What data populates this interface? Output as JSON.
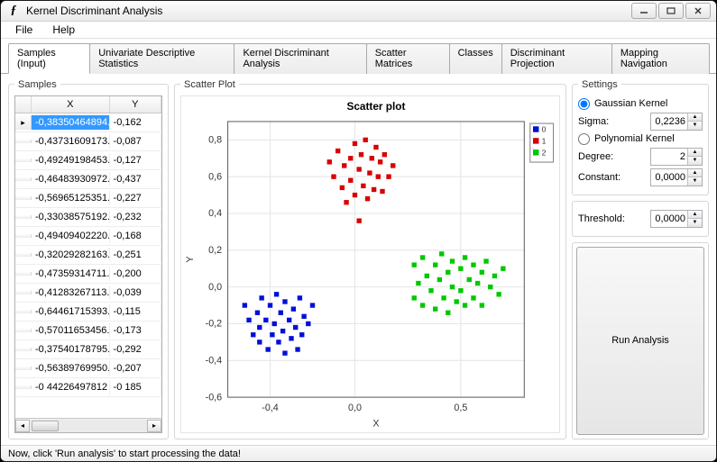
{
  "window": {
    "title": "Kernel Discriminant Analysis"
  },
  "menu": {
    "file": "File",
    "help": "Help"
  },
  "tabs": [
    "Samples (Input)",
    "Univariate Descriptive Statistics",
    "Kernel Discriminant Analysis",
    "Scatter Matrices",
    "Classes",
    "Discriminant Projection",
    "Mapping Navigation"
  ],
  "samples": {
    "legend": "Samples",
    "headers": {
      "x": "X",
      "y": "Y"
    },
    "rows": [
      {
        "x": "-0,38350464894...",
        "y": "-0,162"
      },
      {
        "x": "-0,43731609173...",
        "y": "-0,087"
      },
      {
        "x": "-0,49249198453...",
        "y": "-0,127"
      },
      {
        "x": "-0,46483930972...",
        "y": "-0,437"
      },
      {
        "x": "-0,56965125351...",
        "y": "-0,227"
      },
      {
        "x": "-0,33038575192...",
        "y": "-0,232"
      },
      {
        "x": "-0,49409402220...",
        "y": "-0,168"
      },
      {
        "x": "-0,32029282163...",
        "y": "-0,251"
      },
      {
        "x": "-0,47359314711...",
        "y": "-0,200"
      },
      {
        "x": "-0,41283267113...",
        "y": "-0,039"
      },
      {
        "x": "-0,64461715393...",
        "y": "-0,115"
      },
      {
        "x": "-0,57011653456...",
        "y": "-0,173"
      },
      {
        "x": "-0,37540178795...",
        "y": "-0,292"
      },
      {
        "x": "-0,56389769950...",
        "y": "-0,207"
      },
      {
        "x": "-0 44226497812",
        "y": "-0 185"
      }
    ]
  },
  "scatter": {
    "legend": "Scatter Plot",
    "legend_items": [
      "0",
      "1",
      "2"
    ]
  },
  "chart_data": {
    "type": "scatter",
    "title": "Scatter plot",
    "xlabel": "X",
    "ylabel": "Y",
    "xlim": [
      -0.6,
      0.8
    ],
    "ylim": [
      -0.6,
      0.9
    ],
    "xticks": [
      -0.4,
      0.0,
      0.5
    ],
    "yticks": [
      -0.6,
      -0.4,
      -0.2,
      0.0,
      0.2,
      0.4,
      0.6,
      0.8
    ],
    "series": [
      {
        "name": "0",
        "color": "#0010d8",
        "points": [
          [
            -0.52,
            -0.1
          ],
          [
            -0.5,
            -0.18
          ],
          [
            -0.48,
            -0.26
          ],
          [
            -0.46,
            -0.14
          ],
          [
            -0.45,
            -0.22
          ],
          [
            -0.45,
            -0.3
          ],
          [
            -0.44,
            -0.06
          ],
          [
            -0.42,
            -0.18
          ],
          [
            -0.41,
            -0.34
          ],
          [
            -0.4,
            -0.1
          ],
          [
            -0.39,
            -0.26
          ],
          [
            -0.38,
            -0.2
          ],
          [
            -0.37,
            -0.04
          ],
          [
            -0.36,
            -0.3
          ],
          [
            -0.35,
            -0.14
          ],
          [
            -0.34,
            -0.24
          ],
          [
            -0.33,
            -0.08
          ],
          [
            -0.33,
            -0.36
          ],
          [
            -0.31,
            -0.18
          ],
          [
            -0.3,
            -0.28
          ],
          [
            -0.29,
            -0.12
          ],
          [
            -0.28,
            -0.22
          ],
          [
            -0.27,
            -0.34
          ],
          [
            -0.26,
            -0.06
          ],
          [
            -0.25,
            -0.26
          ],
          [
            -0.24,
            -0.16
          ],
          [
            -0.22,
            -0.2
          ],
          [
            -0.2,
            -0.1
          ]
        ]
      },
      {
        "name": "1",
        "color": "#d80000",
        "points": [
          [
            -0.12,
            0.68
          ],
          [
            -0.1,
            0.6
          ],
          [
            -0.08,
            0.74
          ],
          [
            -0.06,
            0.54
          ],
          [
            -0.05,
            0.66
          ],
          [
            -0.04,
            0.46
          ],
          [
            -0.02,
            0.7
          ],
          [
            -0.02,
            0.58
          ],
          [
            0.0,
            0.78
          ],
          [
            0.0,
            0.5
          ],
          [
            0.02,
            0.64
          ],
          [
            0.02,
            0.36
          ],
          [
            0.03,
            0.72
          ],
          [
            0.04,
            0.55
          ],
          [
            0.05,
            0.8
          ],
          [
            0.06,
            0.48
          ],
          [
            0.07,
            0.62
          ],
          [
            0.08,
            0.7
          ],
          [
            0.09,
            0.53
          ],
          [
            0.1,
            0.76
          ],
          [
            0.11,
            0.6
          ],
          [
            0.12,
            0.68
          ],
          [
            0.13,
            0.52
          ],
          [
            0.14,
            0.72
          ],
          [
            0.16,
            0.6
          ],
          [
            0.18,
            0.66
          ]
        ]
      },
      {
        "name": "2",
        "color": "#00c800",
        "points": [
          [
            0.28,
            0.12
          ],
          [
            0.28,
            -0.06
          ],
          [
            0.3,
            0.02
          ],
          [
            0.32,
            0.16
          ],
          [
            0.32,
            -0.1
          ],
          [
            0.34,
            0.06
          ],
          [
            0.36,
            -0.02
          ],
          [
            0.38,
            0.12
          ],
          [
            0.38,
            -0.12
          ],
          [
            0.4,
            0.04
          ],
          [
            0.41,
            0.18
          ],
          [
            0.42,
            -0.06
          ],
          [
            0.44,
            0.08
          ],
          [
            0.44,
            -0.14
          ],
          [
            0.46,
            0.14
          ],
          [
            0.46,
            0.0
          ],
          [
            0.48,
            -0.08
          ],
          [
            0.5,
            0.1
          ],
          [
            0.5,
            -0.02
          ],
          [
            0.52,
            0.16
          ],
          [
            0.52,
            -0.1
          ],
          [
            0.54,
            0.04
          ],
          [
            0.56,
            0.12
          ],
          [
            0.56,
            -0.06
          ],
          [
            0.58,
            0.02
          ],
          [
            0.6,
            0.08
          ],
          [
            0.6,
            -0.1
          ],
          [
            0.62,
            0.14
          ],
          [
            0.64,
            0.0
          ],
          [
            0.66,
            0.06
          ],
          [
            0.68,
            -0.04
          ],
          [
            0.7,
            0.1
          ]
        ]
      }
    ]
  },
  "settings": {
    "legend": "Settings",
    "gaussian": "Gaussian Kernel",
    "sigma_label": "Sigma:",
    "sigma": "0,2236",
    "polynomial": "Polynomial Kernel",
    "degree_label": "Degree:",
    "degree": "2",
    "constant_label": "Constant:",
    "constant": "0,0000",
    "threshold_label": "Threshold:",
    "threshold": "0,0000",
    "run": "Run Analysis"
  },
  "status": "Now, click 'Run analysis' to start processing the data!"
}
